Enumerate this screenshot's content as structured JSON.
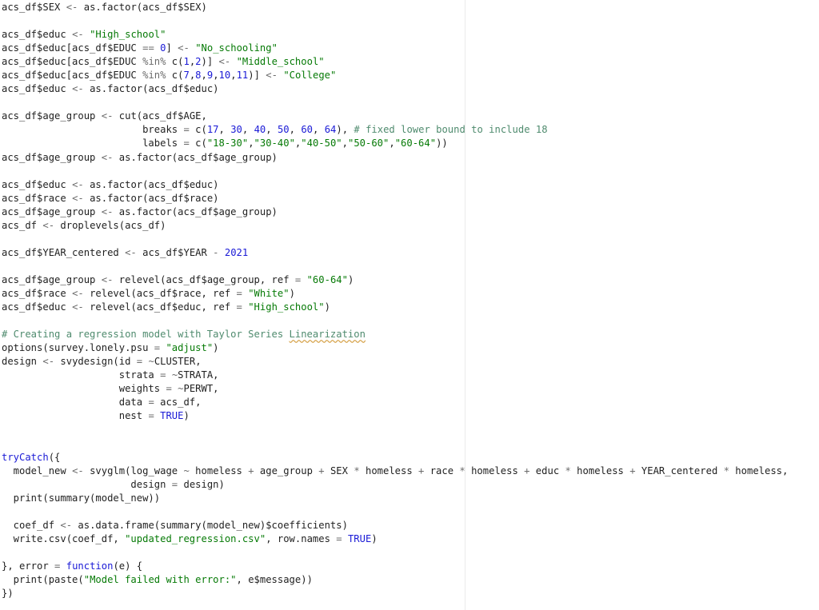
{
  "colors": {
    "background": "#ffffff",
    "text": "#1f1f1f",
    "string": "#067a06",
    "number": "#1a1ad6",
    "keyword": "#1a1ad6",
    "comment": "#4f8b6e",
    "operator": "#6b6b6b",
    "margin_line": "#ebebeb",
    "spellcheck_underline": "#d7a34b"
  },
  "editor": {
    "language": "R",
    "lines": [
      [
        [
          "plain",
          "acs_df$SEX "
        ],
        [
          "op",
          "<-"
        ],
        [
          "plain",
          " as.factor(acs_df$SEX)"
        ]
      ],
      [],
      [
        [
          "plain",
          "acs_df$educ "
        ],
        [
          "op",
          "<-"
        ],
        [
          "plain",
          " "
        ],
        [
          "str",
          "\"High_school\""
        ]
      ],
      [
        [
          "plain",
          "acs_df$educ[acs_df$EDUC "
        ],
        [
          "op",
          "=="
        ],
        [
          "plain",
          " "
        ],
        [
          "num",
          "0"
        ],
        [
          "plain",
          "] "
        ],
        [
          "op",
          "<-"
        ],
        [
          "plain",
          " "
        ],
        [
          "str",
          "\"No_schooling\""
        ]
      ],
      [
        [
          "plain",
          "acs_df$educ[acs_df$EDUC "
        ],
        [
          "op",
          "%in%"
        ],
        [
          "plain",
          " c("
        ],
        [
          "num",
          "1"
        ],
        [
          "plain",
          ","
        ],
        [
          "num",
          "2"
        ],
        [
          "plain",
          ")] "
        ],
        [
          "op",
          "<-"
        ],
        [
          "plain",
          " "
        ],
        [
          "str",
          "\"Middle_school\""
        ]
      ],
      [
        [
          "plain",
          "acs_df$educ[acs_df$EDUC "
        ],
        [
          "op",
          "%in%"
        ],
        [
          "plain",
          " c("
        ],
        [
          "num",
          "7"
        ],
        [
          "plain",
          ","
        ],
        [
          "num",
          "8"
        ],
        [
          "plain",
          ","
        ],
        [
          "num",
          "9"
        ],
        [
          "plain",
          ","
        ],
        [
          "num",
          "10"
        ],
        [
          "plain",
          ","
        ],
        [
          "num",
          "11"
        ],
        [
          "plain",
          ")] "
        ],
        [
          "op",
          "<-"
        ],
        [
          "plain",
          " "
        ],
        [
          "str",
          "\"College\""
        ]
      ],
      [
        [
          "plain",
          "acs_df$educ "
        ],
        [
          "op",
          "<-"
        ],
        [
          "plain",
          " as.factor(acs_df$educ)"
        ]
      ],
      [],
      [
        [
          "plain",
          "acs_df$age_group "
        ],
        [
          "op",
          "<-"
        ],
        [
          "plain",
          " cut(acs_df$AGE,"
        ]
      ],
      [
        [
          "plain",
          "                        breaks "
        ],
        [
          "op",
          "="
        ],
        [
          "plain",
          " c("
        ],
        [
          "num",
          "17"
        ],
        [
          "plain",
          ", "
        ],
        [
          "num",
          "30"
        ],
        [
          "plain",
          ", "
        ],
        [
          "num",
          "40"
        ],
        [
          "plain",
          ", "
        ],
        [
          "num",
          "50"
        ],
        [
          "plain",
          ", "
        ],
        [
          "num",
          "60"
        ],
        [
          "plain",
          ", "
        ],
        [
          "num",
          "64"
        ],
        [
          "plain",
          "), "
        ],
        [
          "com",
          "# fixed lower bound to include 18"
        ]
      ],
      [
        [
          "plain",
          "                        labels "
        ],
        [
          "op",
          "="
        ],
        [
          "plain",
          " c("
        ],
        [
          "str",
          "\"18-30\""
        ],
        [
          "plain",
          ","
        ],
        [
          "str",
          "\"30-40\""
        ],
        [
          "plain",
          ","
        ],
        [
          "str",
          "\"40-50\""
        ],
        [
          "plain",
          ","
        ],
        [
          "str",
          "\"50-60\""
        ],
        [
          "plain",
          ","
        ],
        [
          "str",
          "\"60-64\""
        ],
        [
          "plain",
          "))"
        ]
      ],
      [
        [
          "plain",
          "acs_df$age_group "
        ],
        [
          "op",
          "<-"
        ],
        [
          "plain",
          " as.factor(acs_df$age_group)"
        ]
      ],
      [],
      [
        [
          "plain",
          "acs_df$educ "
        ],
        [
          "op",
          "<-"
        ],
        [
          "plain",
          " as.factor(acs_df$educ)"
        ]
      ],
      [
        [
          "plain",
          "acs_df$race "
        ],
        [
          "op",
          "<-"
        ],
        [
          "plain",
          " as.factor(acs_df$race)"
        ]
      ],
      [
        [
          "plain",
          "acs_df$age_group "
        ],
        [
          "op",
          "<-"
        ],
        [
          "plain",
          " as.factor(acs_df$age_group)"
        ]
      ],
      [
        [
          "plain",
          "acs_df "
        ],
        [
          "op",
          "<-"
        ],
        [
          "plain",
          " droplevels(acs_df)"
        ]
      ],
      [],
      [
        [
          "plain",
          "acs_df$YEAR_centered "
        ],
        [
          "op",
          "<-"
        ],
        [
          "plain",
          " acs_df$YEAR "
        ],
        [
          "op",
          "-"
        ],
        [
          "plain",
          " "
        ],
        [
          "num",
          "2021"
        ]
      ],
      [],
      [
        [
          "plain",
          "acs_df$age_group "
        ],
        [
          "op",
          "<-"
        ],
        [
          "plain",
          " relevel(acs_df$age_group, ref "
        ],
        [
          "op",
          "="
        ],
        [
          "plain",
          " "
        ],
        [
          "str",
          "\"60-64\""
        ],
        [
          "plain",
          ")"
        ]
      ],
      [
        [
          "plain",
          "acs_df$race "
        ],
        [
          "op",
          "<-"
        ],
        [
          "plain",
          " relevel(acs_df$race, ref "
        ],
        [
          "op",
          "="
        ],
        [
          "plain",
          " "
        ],
        [
          "str",
          "\"White\""
        ],
        [
          "plain",
          ")"
        ]
      ],
      [
        [
          "plain",
          "acs_df$educ "
        ],
        [
          "op",
          "<-"
        ],
        [
          "plain",
          " relevel(acs_df$educ, ref "
        ],
        [
          "op",
          "="
        ],
        [
          "plain",
          " "
        ],
        [
          "str",
          "\"High_school\""
        ],
        [
          "plain",
          ")"
        ]
      ],
      [],
      [
        [
          "com",
          "# Creating a regression model with Taylor Series "
        ],
        [
          "comspell",
          "Linearization"
        ]
      ],
      [
        [
          "plain",
          "options(survey.lonely.psu "
        ],
        [
          "op",
          "="
        ],
        [
          "plain",
          " "
        ],
        [
          "str",
          "\"adjust\""
        ],
        [
          "plain",
          ")"
        ]
      ],
      [
        [
          "plain",
          "design "
        ],
        [
          "op",
          "<-"
        ],
        [
          "plain",
          " svydesign(id "
        ],
        [
          "op",
          "="
        ],
        [
          "plain",
          " "
        ],
        [
          "op",
          "~"
        ],
        [
          "plain",
          "CLUSTER,"
        ]
      ],
      [
        [
          "plain",
          "                    strata "
        ],
        [
          "op",
          "="
        ],
        [
          "plain",
          " "
        ],
        [
          "op",
          "~"
        ],
        [
          "plain",
          "STRATA,"
        ]
      ],
      [
        [
          "plain",
          "                    weights "
        ],
        [
          "op",
          "="
        ],
        [
          "plain",
          " "
        ],
        [
          "op",
          "~"
        ],
        [
          "plain",
          "PERWT,"
        ]
      ],
      [
        [
          "plain",
          "                    data "
        ],
        [
          "op",
          "="
        ],
        [
          "plain",
          " acs_df,"
        ]
      ],
      [
        [
          "plain",
          "                    nest "
        ],
        [
          "op",
          "="
        ],
        [
          "plain",
          " "
        ],
        [
          "kw",
          "TRUE"
        ],
        [
          "plain",
          ")"
        ]
      ],
      [],
      [],
      [
        [
          "kw",
          "tryCatch"
        ],
        [
          "plain",
          "({"
        ]
      ],
      [
        [
          "plain",
          "  model_new "
        ],
        [
          "op",
          "<-"
        ],
        [
          "plain",
          " svyglm(log_wage "
        ],
        [
          "op",
          "~"
        ],
        [
          "plain",
          " homeless "
        ],
        [
          "op",
          "+"
        ],
        [
          "plain",
          " age_group "
        ],
        [
          "op",
          "+"
        ],
        [
          "plain",
          " SEX "
        ],
        [
          "op",
          "*"
        ],
        [
          "plain",
          " homeless "
        ],
        [
          "op",
          "+"
        ],
        [
          "plain",
          " race "
        ],
        [
          "op",
          "*"
        ],
        [
          "plain",
          " homeless "
        ],
        [
          "op",
          "+"
        ],
        [
          "plain",
          " educ "
        ],
        [
          "op",
          "*"
        ],
        [
          "plain",
          " homeless "
        ],
        [
          "op",
          "+"
        ],
        [
          "plain",
          " YEAR_centered "
        ],
        [
          "op",
          "*"
        ],
        [
          "plain",
          " homeless,"
        ]
      ],
      [
        [
          "plain",
          "                      design "
        ],
        [
          "op",
          "="
        ],
        [
          "plain",
          " design)"
        ]
      ],
      [
        [
          "plain",
          "  print(summary(model_new))"
        ]
      ],
      [],
      [
        [
          "plain",
          "  coef_df "
        ],
        [
          "op",
          "<-"
        ],
        [
          "plain",
          " as.data.frame(summary(model_new)$coefficients)"
        ]
      ],
      [
        [
          "plain",
          "  write.csv(coef_df, "
        ],
        [
          "str",
          "\"updated_regression.csv\""
        ],
        [
          "plain",
          ", row.names "
        ],
        [
          "op",
          "="
        ],
        [
          "plain",
          " "
        ],
        [
          "kw",
          "TRUE"
        ],
        [
          "plain",
          ")"
        ]
      ],
      [],
      [
        [
          "plain",
          "}, error "
        ],
        [
          "op",
          "="
        ],
        [
          "plain",
          " "
        ],
        [
          "kw",
          "function"
        ],
        [
          "plain",
          "(e) {"
        ]
      ],
      [
        [
          "plain",
          "  print(paste("
        ],
        [
          "str",
          "\"Model failed with error:\""
        ],
        [
          "plain",
          ", e$message))"
        ]
      ],
      [
        [
          "plain",
          "})"
        ]
      ]
    ]
  }
}
